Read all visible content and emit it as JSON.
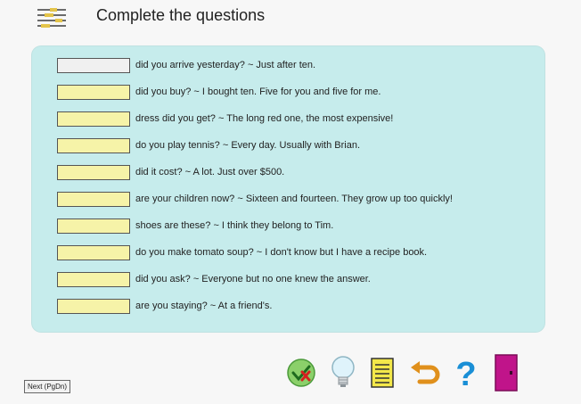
{
  "header": {
    "title": "Complete the questions",
    "menu_icon": "list-icon"
  },
  "questions": [
    {
      "text": "did you arrive yesterday? ~ Just after ten.",
      "answer": ""
    },
    {
      "text": "did you buy? ~ I bought ten. Five for you and five for me.",
      "answer": ""
    },
    {
      "text": "dress did you get? ~ The long red one, the most expensive!",
      "answer": ""
    },
    {
      "text": "do you play tennis? ~ Every day. Usually with Brian.",
      "answer": ""
    },
    {
      "text": "did it cost? ~ A lot. Just over $500.",
      "answer": ""
    },
    {
      "text": "are your children now? ~ Sixteen and fourteen. They grow up too quickly!",
      "answer": ""
    },
    {
      "text": "shoes are these? ~ I think they belong to Tim.",
      "answer": ""
    },
    {
      "text": "do you make tomato soup? ~ I don't know but I have a recipe book.",
      "answer": ""
    },
    {
      "text": "did you ask? ~ Everyone but no one knew the answer.",
      "answer": ""
    },
    {
      "text": "are you staying? ~ At a friend's.",
      "answer": ""
    }
  ],
  "footer": {
    "next_label": "Next (PgDn)"
  },
  "toolbar": {
    "icons": [
      "check-answers-icon",
      "hint-lightbulb-icon",
      "notepad-icon",
      "undo-icon",
      "help-icon",
      "exit-door-icon"
    ]
  },
  "colors": {
    "panel": "#c6ecec",
    "answer_box": "#f6f3a8",
    "active_box": "#f0f0f0",
    "exit": "#c0148a",
    "help": "#1a8fd6",
    "undo": "#e0901c"
  }
}
